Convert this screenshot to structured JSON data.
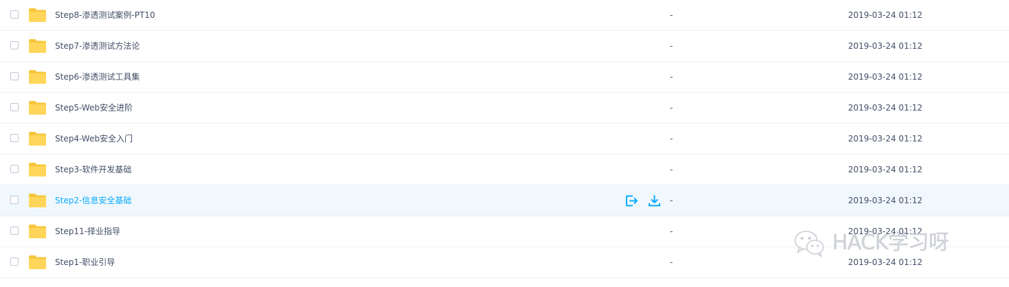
{
  "files": [
    {
      "name": "Step8-渗透测试案例-PT10",
      "size": "-",
      "modified": "2019-03-24 01:12",
      "hovered": false
    },
    {
      "name": "Step7-渗透测试方法论",
      "size": "-",
      "modified": "2019-03-24 01:12",
      "hovered": false
    },
    {
      "name": "Step6-渗透测试工具集",
      "size": "-",
      "modified": "2019-03-24 01:12",
      "hovered": false
    },
    {
      "name": "Step5-Web安全进阶",
      "size": "-",
      "modified": "2019-03-24 01:12",
      "hovered": false
    },
    {
      "name": "Step4-Web安全入门",
      "size": "-",
      "modified": "2019-03-24 01:12",
      "hovered": false
    },
    {
      "name": "Step3-软件开发基础",
      "size": "-",
      "modified": "2019-03-24 01:12",
      "hovered": false
    },
    {
      "name": "Step2-信息安全基础",
      "size": "-",
      "modified": "2019-03-24 01:12",
      "hovered": true
    },
    {
      "name": "Step11-择业指导",
      "size": "-",
      "modified": "2019-03-24 01:12",
      "hovered": false
    },
    {
      "name": "Step1-职业引导",
      "size": "-",
      "modified": "2019-03-24 01:12",
      "hovered": false
    }
  ],
  "hover_actions": [
    {
      "icon": "share-icon"
    },
    {
      "icon": "download-icon"
    }
  ],
  "watermark": {
    "text": "HACK学习呀",
    "icon": "wechat-logo"
  },
  "colors": {
    "accent": "#09aaff",
    "text": "#424e67",
    "folder": "#ffd659",
    "folder_dark": "#f6c63b",
    "hover_bg": "#f0f8fd",
    "divider": "#f1f2f4",
    "watermark": "#cdd0d6"
  }
}
